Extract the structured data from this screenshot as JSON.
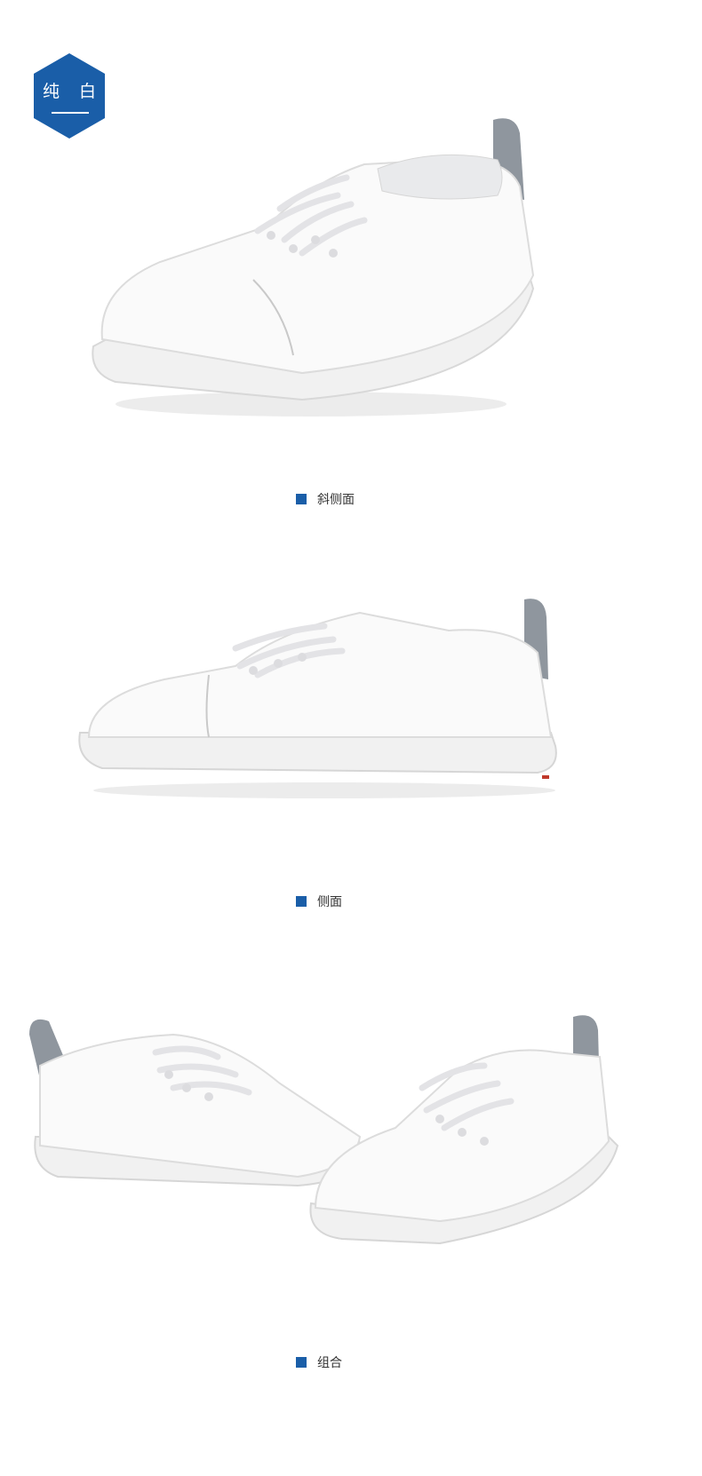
{
  "badge": {
    "label": "纯 白"
  },
  "captions": {
    "oblique": "斜侧面",
    "side": "侧面",
    "combo": "组合"
  },
  "colors": {
    "accent": "#1a5ea8",
    "heel_tab": "#8f969e"
  }
}
